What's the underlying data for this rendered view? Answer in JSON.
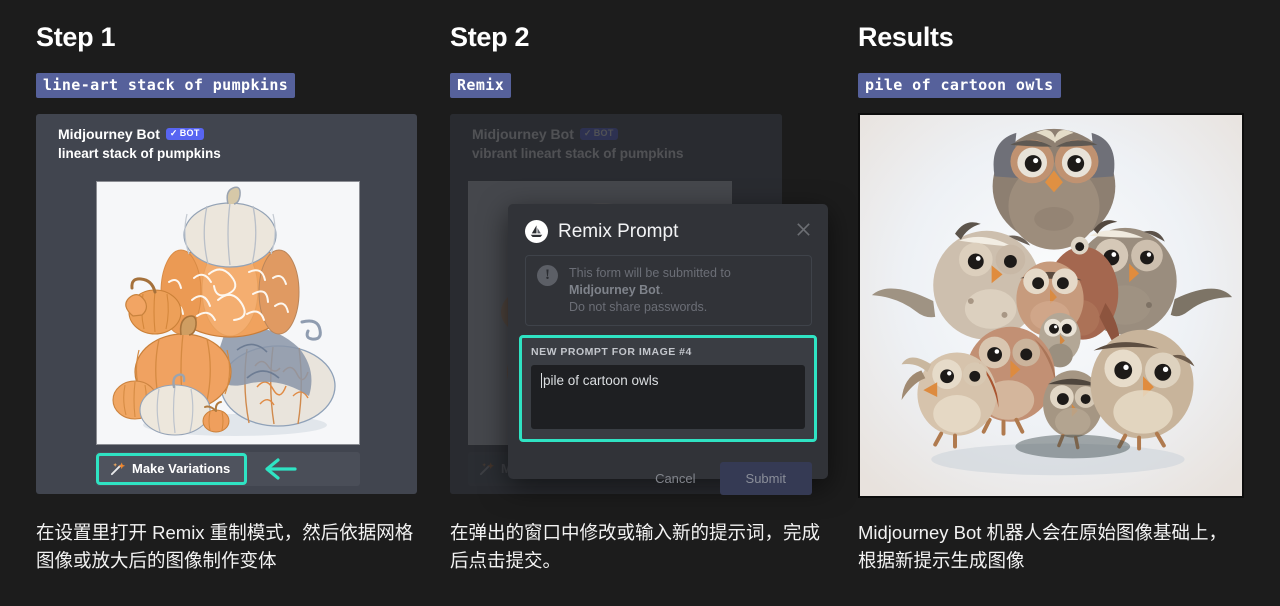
{
  "background_color": "#1c1c1c",
  "accent_teal": "#2fe3c3",
  "chip_blue": "#56619b",
  "columns": [
    {
      "id": "step-1",
      "heading": "Step 1",
      "prompt_chip": "line-art stack of pumpkins",
      "discord": {
        "author": "Midjourney Bot",
        "bot_badge": "BOT",
        "bot_badge_check": "✓",
        "message_prompt": "lineart stack of pumpkins",
        "image_alt": "lineart stack of pumpkins illustration",
        "variations_button": "Make Variations",
        "wand_icon": "magic-wand-icon",
        "arrow_icon": "arrow-left-icon"
      },
      "caption": "在设置里打开 Remix 重制模式，然后依据网格图像或放大后的图像制作变体"
    },
    {
      "id": "step-2",
      "heading": "Step 2",
      "prompt_chip": "Remix",
      "discord": {
        "author": "Midjourney Bot",
        "bot_badge": "BOT",
        "bot_badge_check": "✓",
        "message_prompt": "vibrant lineart stack of pumpkins",
        "variations_button": "Make Variations"
      },
      "modal": {
        "logo_icon": "midjourney-sailboat-icon",
        "title": "Remix Prompt",
        "close_icon": "close-icon",
        "warning_icon": "warning-icon",
        "warning_text_1": "This form will be submitted to ",
        "warning_bold": "Midjourney Bot",
        "warning_text_2": ".",
        "warning_line_2": "Do not share passwords.",
        "field_label": "NEW PROMPT FOR IMAGE #4",
        "field_value": "pile of cartoon owls",
        "cancel_label": "Cancel",
        "submit_label": "Submit"
      },
      "caption": "在弹出的窗口中修改或输入新的提示词，完成后点击提交。"
    },
    {
      "id": "results",
      "heading": "Results",
      "prompt_chip": "pile of cartoon owls",
      "result_image_alt": "pile of cartoon owls illustration",
      "caption": "Midjourney Bot 机器人会在原始图像基础上，根据新提示生成图像"
    }
  ]
}
